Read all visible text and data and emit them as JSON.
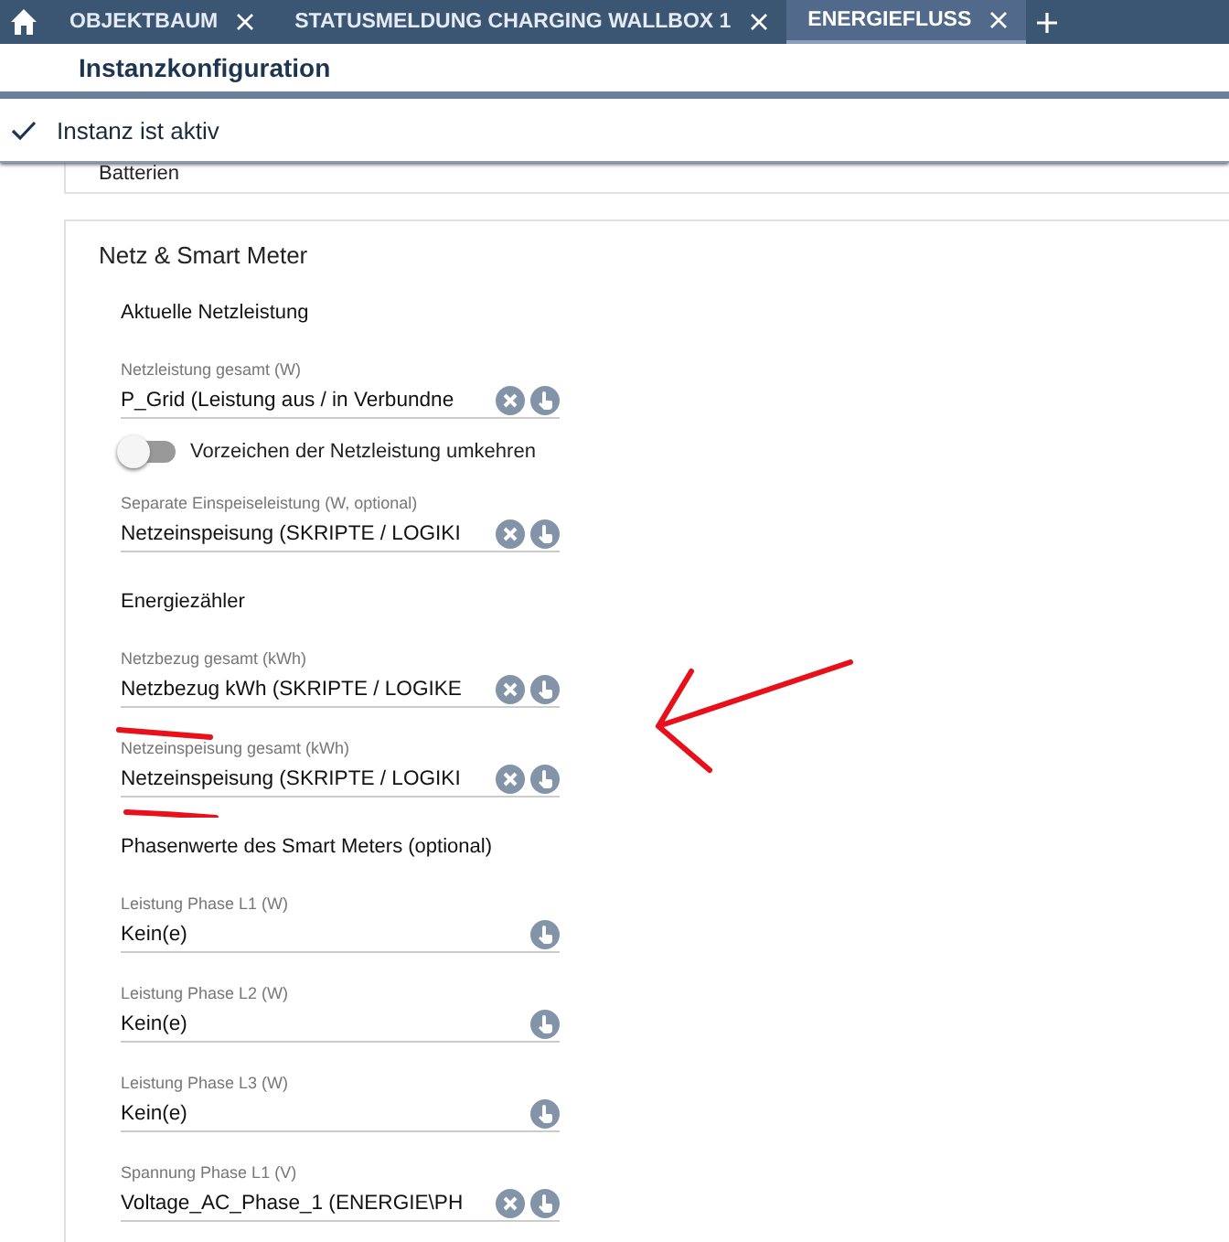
{
  "tabs": [
    {
      "label": "OBJEKTBAUM",
      "selected": false
    },
    {
      "label": "STATUSMELDUNG CHARGING WALLBOX 1",
      "selected": false
    },
    {
      "label": "ENERGIEFLUSS",
      "selected": true
    }
  ],
  "header": {
    "title": "Instanzkonfiguration"
  },
  "instance": {
    "label": "Instanz ist aktiv",
    "checked": true
  },
  "sections": [
    {
      "title": "Batterien"
    },
    {
      "title": "Netz & Smart Meter",
      "items": [
        {
          "kind": "heading",
          "text": "Aktuelle Netzleistung"
        },
        {
          "kind": "field",
          "label": "Netzleistung gesamt (W)",
          "value": "P_Grid (Leistung aus / in Verbundne",
          "clearable": true
        },
        {
          "kind": "toggle",
          "label": "Vorzeichen der Netzleistung umkehren",
          "on": false
        },
        {
          "kind": "field",
          "label": "Separate Einspeiseleistung (W, optional)",
          "value": "Netzeinspeisung (SKRIPTE / LOGIKI",
          "clearable": true
        },
        {
          "kind": "heading",
          "text": "Energiezähler"
        },
        {
          "kind": "field",
          "label": "Netzbezug gesamt (kWh)",
          "value": "Netzbezug kWh (SKRIPTE / LOGIKE",
          "clearable": true
        },
        {
          "kind": "field",
          "label": "Netzeinspeisung gesamt (kWh)",
          "value": "Netzeinspeisung (SKRIPTE / LOGIKI",
          "clearable": true
        },
        {
          "kind": "heading",
          "text": "Phasenwerte des Smart Meters (optional)"
        },
        {
          "kind": "field",
          "label": "Leistung Phase L1 (W)",
          "value": "Kein(e)",
          "clearable": false
        },
        {
          "kind": "field",
          "label": "Leistung Phase L2 (W)",
          "value": "Kein(e)",
          "clearable": false
        },
        {
          "kind": "field",
          "label": "Leistung Phase L3 (W)",
          "value": "Kein(e)",
          "clearable": false
        },
        {
          "kind": "field",
          "label": "Spannung Phase L1 (V)",
          "value": "Voltage_AC_Phase_1 (ENERGIE\\PH",
          "clearable": true
        }
      ]
    }
  ]
}
